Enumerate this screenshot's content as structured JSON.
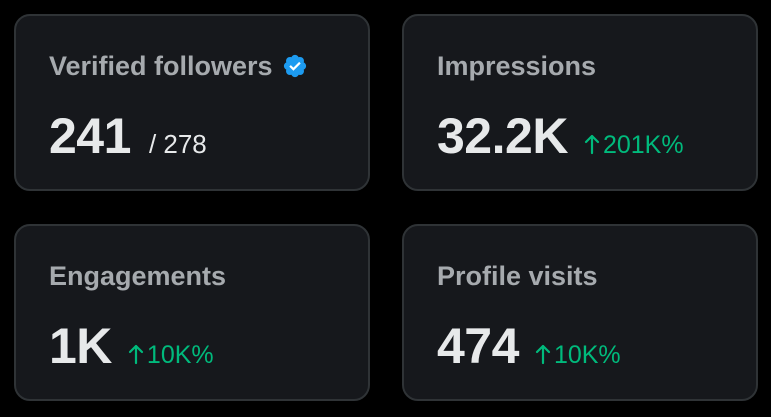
{
  "colors": {
    "background": "#000000",
    "card_background": "#16181c",
    "card_border": "#2f3336",
    "title_text": "#a6aaae",
    "value_text": "#e7e9ea",
    "positive_delta": "#00ba7c",
    "verified_badge": "#1d9bf0"
  },
  "cards": [
    {
      "title": "Verified followers",
      "title_icon": "verified-badge-icon",
      "value": "241",
      "secondary": "/ 278"
    },
    {
      "title": "Impressions",
      "value": "32.2K",
      "delta": "201K%",
      "delta_icon": "arrow-up-icon"
    },
    {
      "title": "Engagements",
      "value": "1K",
      "delta": "10K%",
      "delta_icon": "arrow-up-icon"
    },
    {
      "title": "Profile visits",
      "value": "474",
      "delta": "10K%",
      "delta_icon": "arrow-up-icon"
    }
  ]
}
